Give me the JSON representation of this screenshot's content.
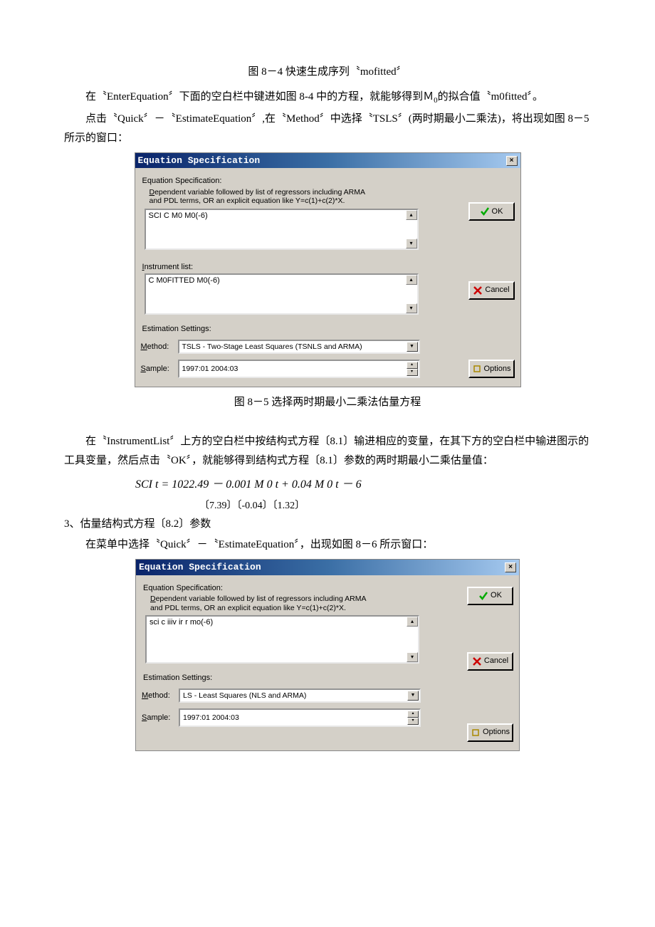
{
  "caption_84": "图 8－4 快速生成序列〝mofitted〞",
  "para1_a": "在〝EnterEquation〞下面的空白栏中键进如图 8-4 中的方程，就能够得到Ｍ",
  "para1_sub": "0",
  "para1_b": "的拟合值〝m0fitted〞。",
  "para2": "点击〝Quick〞－〝EstimateEquation〞,在〝Method〞中选择〝TSLS〞(两时期最小二乘法)，将出现如图 8－5 所示的窗口：",
  "dialogA": {
    "title": "Equation Specification",
    "spec_label": "Equation Specification:",
    "spec_help1": "Dependent variable followed by list of regressors including ARMA",
    "spec_help2": "and PDL terms, OR an explicit equation like Y=c(1)+c(2)*X.",
    "spec_value": "SCI C M0 M0(-6)",
    "instr_label": "Instrument list:",
    "instr_value": "C M0FITTED M0(-6)",
    "settings_label": "Estimation Settings:",
    "method_label": "Method:",
    "method_value": "TSLS  -  Two-Stage Least Squares (TSNLS and ARMA)",
    "sample_label": "Sample:",
    "sample_value": "1997:01 2004:03",
    "btn_ok": "OK",
    "btn_cancel": "Cancel",
    "btn_options": "Options"
  },
  "caption_85": "图 8－5 选择两时期最小二乘法估量方程",
  "para3": "在〝InstrumentList〞上方的空白栏中按结构式方程〔8.1〕输进相应的变量，在其下方的空白栏中输进图示的工具变量，然后点击〝OK〞，就能够得到结构式方程〔8.1〕参数的两时期最小二乘估量值：",
  "equation": {
    "line": "SCI  t  =  1022.49    －  0.001   M   0 t  +  0.04   M   0 t － 6",
    "tvals": "〔7.39〕〔-0.04〕〔1.32〕"
  },
  "para4": "3、估量结构式方程〔8.2〕参数",
  "para5": "在菜单中选择〝Quick〞－〝EstimateEquation〞，出现如图 8－6 所示窗口：",
  "dialogB": {
    "title": "Equation Specification",
    "spec_label": "Equation Specification:",
    "spec_help1": "Dependent variable followed by list of regressors including ARMA",
    "spec_help2": "and PDL terms, OR an explicit equation like Y=c(1)+c(2)*X.",
    "spec_value": "sci c iiiv ir r mo(-6)",
    "settings_label": "Estimation Settings:",
    "method_label": "Method:",
    "method_value": "LS  -  Least Squares (NLS and ARMA)",
    "sample_label": "Sample:",
    "sample_value": "1997:01 2004:03",
    "btn_ok": "OK",
    "btn_cancel": "Cancel",
    "btn_options": "Options"
  }
}
